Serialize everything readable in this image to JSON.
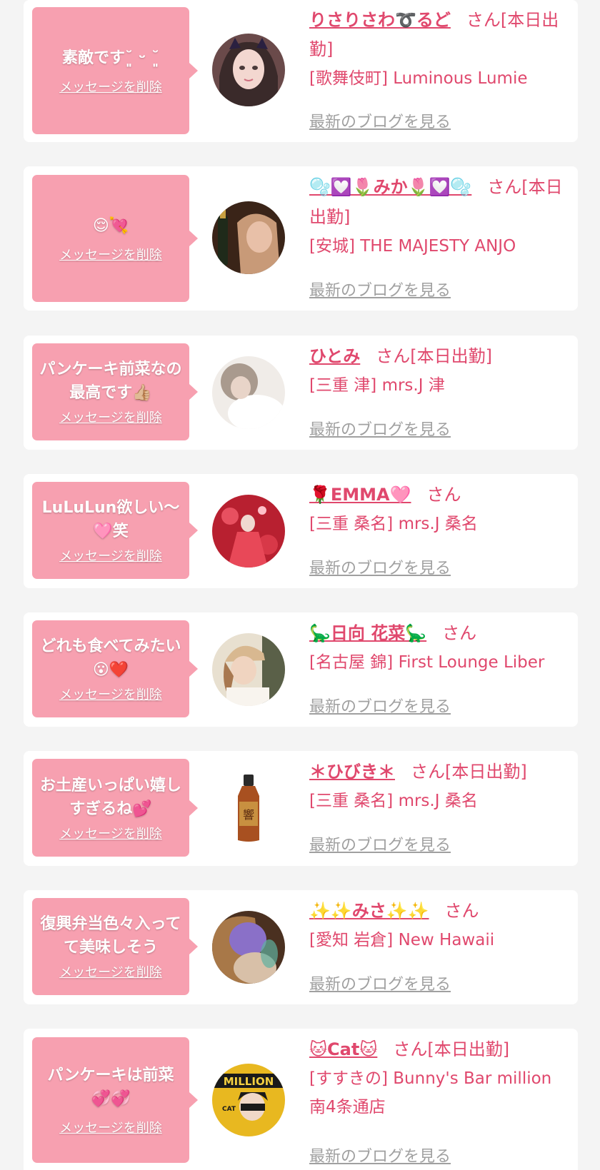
{
  "colors": {
    "background": "#f4f4f4",
    "card": "#ffffff",
    "bubble": "#f7a0b0",
    "accent": "#e0486d",
    "link_gray": "#a0a0a0"
  },
  "items": [
    {
      "message": "素敵です˘͈ ᵕ ˘͈",
      "delete_label": "メッセージを削除",
      "avatar_icon": "girl-with-cat-ears-avatar",
      "name": "りさりさわ➰るど",
      "san": "さん[本日出勤]",
      "shop": "[歌舞伎町] Luminous Lumie",
      "blog_label": "最新のブログを見る"
    },
    {
      "message": "😌💘",
      "delete_label": "メッセージを削除",
      "avatar_icon": "girl-with-bottle-avatar",
      "name": "🫧💟🌷みか🌷💟🫧",
      "san": "さん[本日出勤]",
      "shop": "[安城] THE MAJESTY ANJO",
      "blog_label": "最新のブログを見る"
    },
    {
      "message": "パンケーキ前菜なの最高です👍🏼",
      "delete_label": "メッセージを削除",
      "avatar_icon": "blurred-girl-avatar",
      "name": "ひとみ",
      "san": "さん[本日出勤]",
      "shop": "[三重 津] mrs.J 津",
      "blog_label": "最新のブログを見る"
    },
    {
      "message": "LuLuLun欲しい〜🩷笑",
      "delete_label": "メッセージを削除",
      "avatar_icon": "red-dress-avatar",
      "name": "🌹EMMA🩷",
      "san": "さん",
      "shop": "[三重 桑名] mrs.J 桑名",
      "blog_label": "最新のブログを見る"
    },
    {
      "message": "どれも食べてみたい😮❤️",
      "delete_label": "メッセージを削除",
      "avatar_icon": "girl-with-cap-avatar",
      "name": "🦕日向 花菜🦕",
      "san": "さん",
      "shop": "[名古屋 錦] First Lounge Liber",
      "blog_label": "最新のブログを見る"
    },
    {
      "message": "お土産いっぱい嬉しすぎるね💕",
      "delete_label": "メッセージを削除",
      "avatar_icon": "whisky-bottle-icon",
      "name": "＊ひびき＊",
      "san": "さん[本日出勤]",
      "shop": "[三重 桑名] mrs.J 桑名",
      "blog_label": "最新のブログを見る"
    },
    {
      "message": "復興弁当色々入ってて美味しそう",
      "delete_label": "メッセージを削除",
      "avatar_icon": "girl-hiding-face-avatar",
      "name": "✨✨みさ✨✨",
      "san": "さん",
      "shop": "[愛知 岩倉] New Hawaii",
      "blog_label": "最新のブログを見る"
    },
    {
      "message": "パンケーキは前菜💞💞",
      "delete_label": "メッセージを削除",
      "avatar_icon": "magazine-cover-avatar",
      "name": "🐱Cat🐱",
      "san": "さん[本日出勤]",
      "shop": "[すすきの] Bunny's Bar million 南4条通店",
      "blog_label": "最新のブログを見る"
    }
  ]
}
